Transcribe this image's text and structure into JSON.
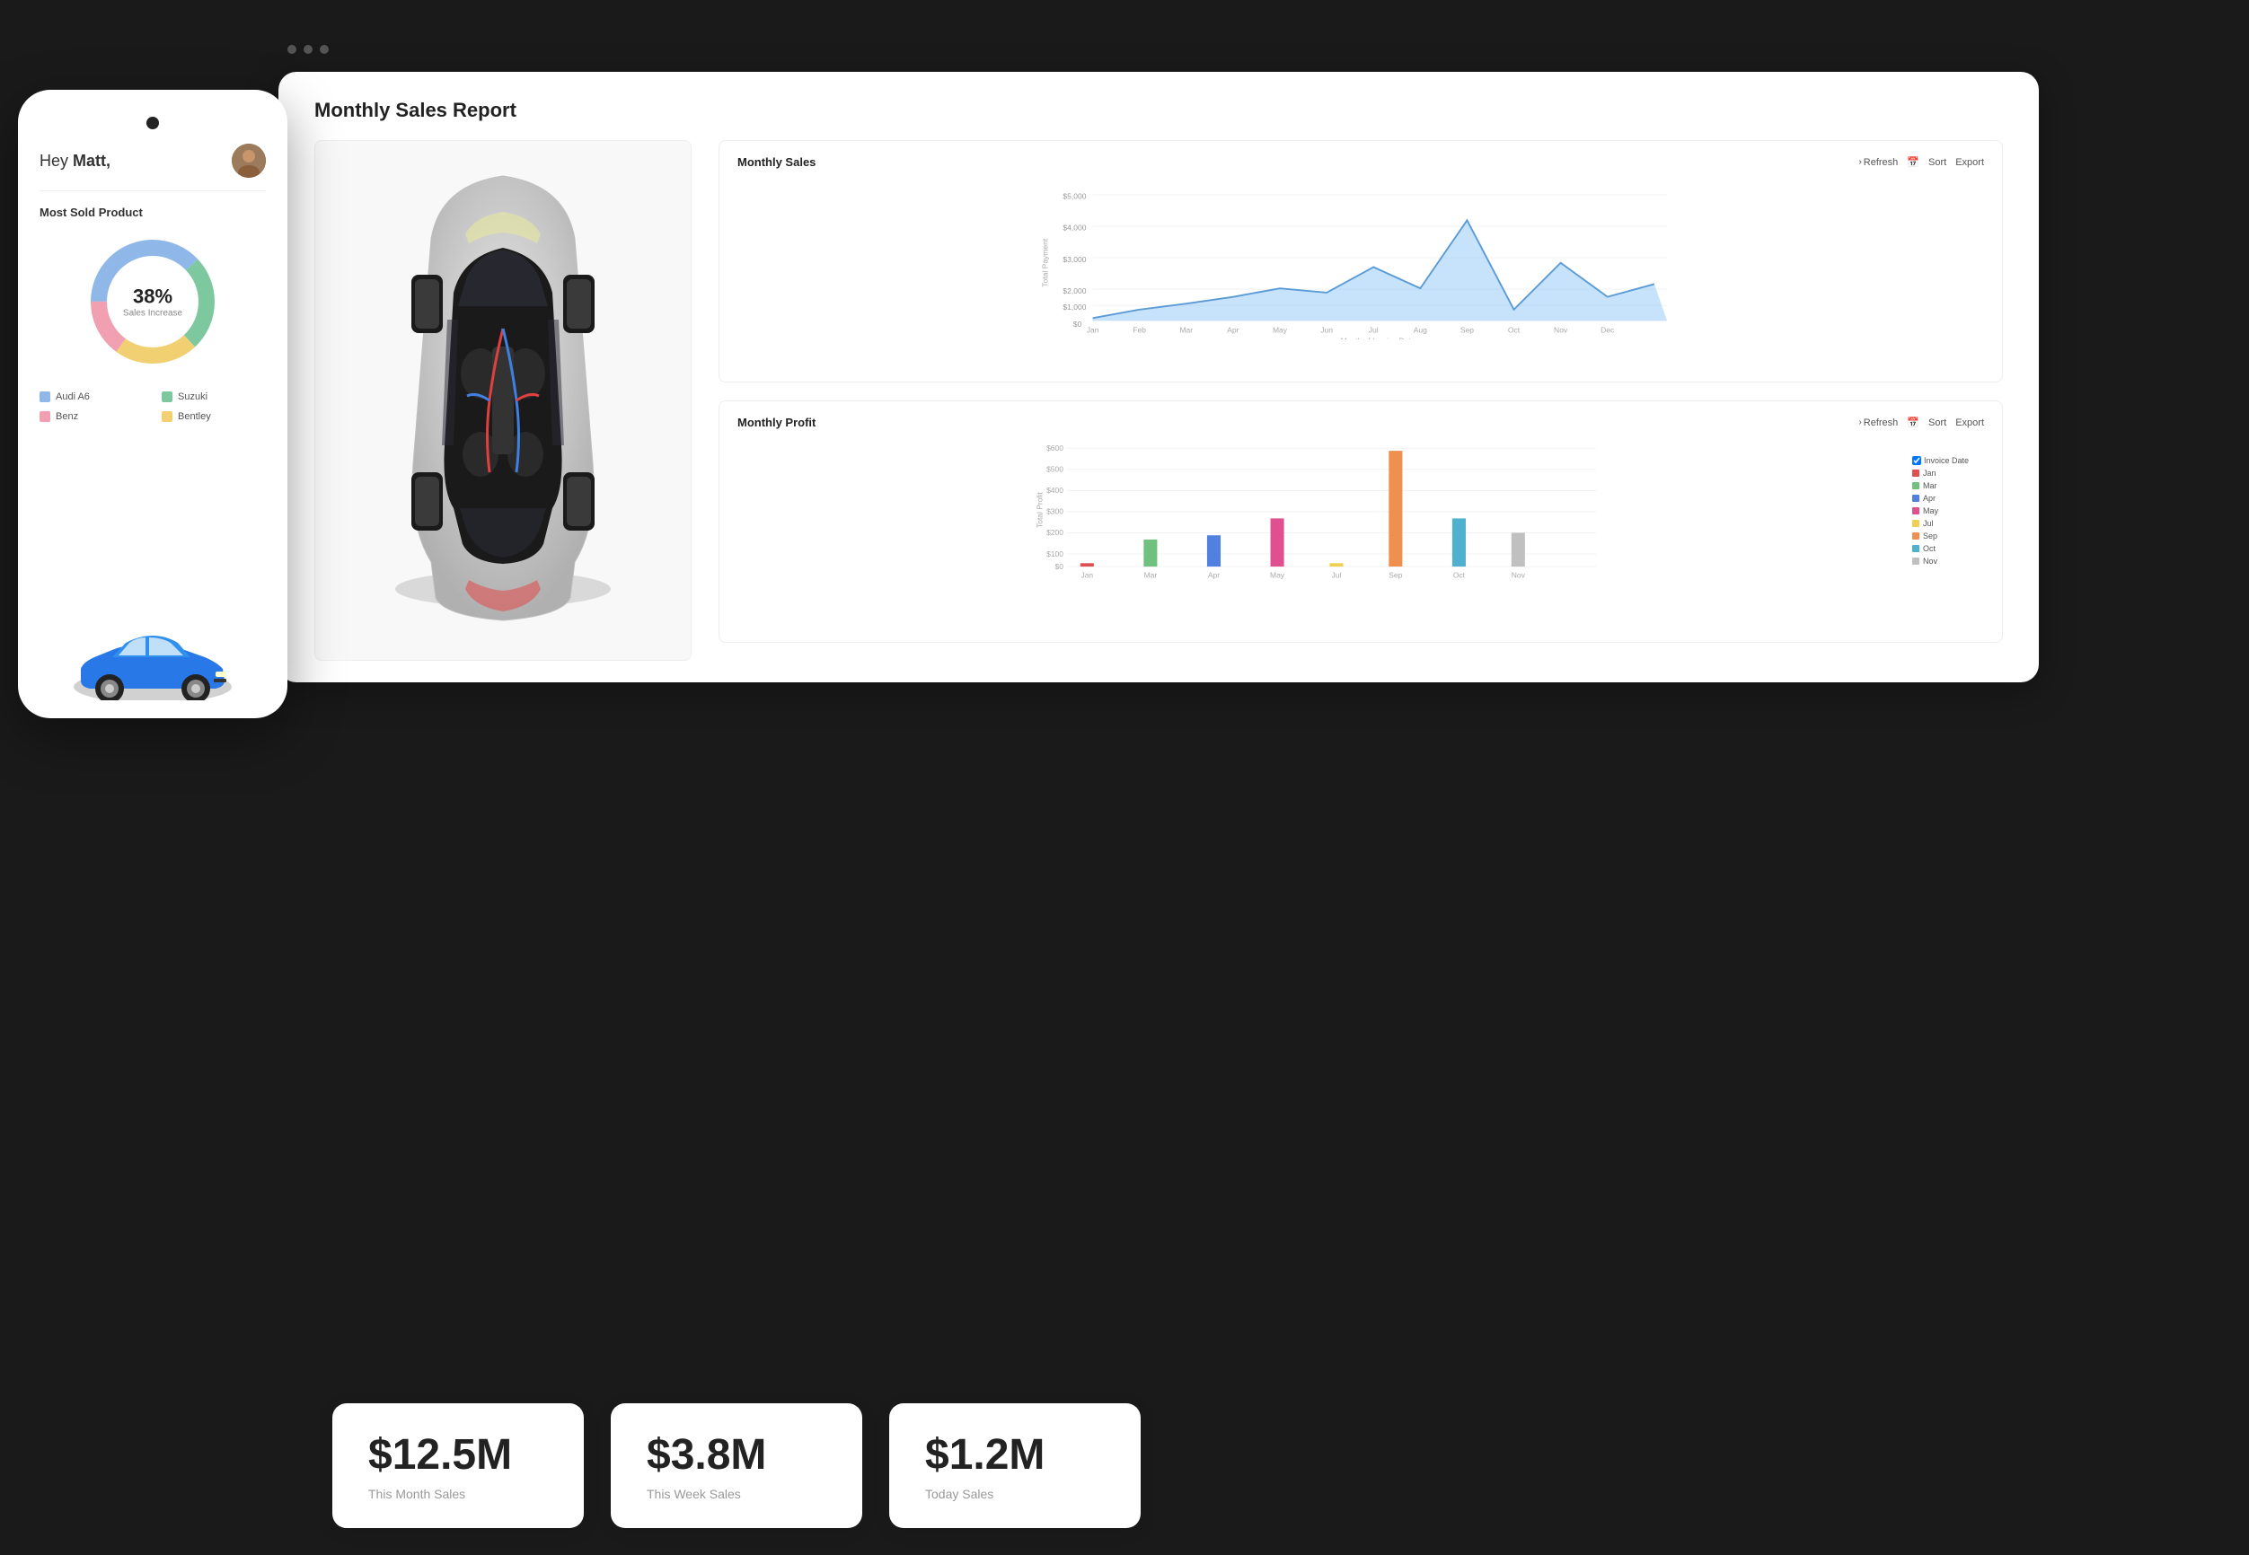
{
  "phone": {
    "greeting": "Hey ",
    "username": "Matt,",
    "most_sold_title": "Most Sold Product",
    "donut_percent": "38%",
    "donut_sub": "Sales Increase",
    "legend": [
      {
        "label": "Audi A6",
        "color": "#8FB8E8"
      },
      {
        "label": "Suzuki",
        "color": "#7EC8A0"
      },
      {
        "label": "Benz",
        "color": "#F0A0B0"
      },
      {
        "label": "Bentley",
        "color": "#F0D070"
      }
    ]
  },
  "dashboard": {
    "title": "Monthly Sales Report",
    "monthly_sales_chart": {
      "title": "Monthly Sales",
      "refresh_label": "Refresh",
      "sort_label": "Sort",
      "export_label": "Export",
      "y_axis_label": "Total Payment",
      "x_axis_label": "Month of Invoice Date",
      "y_ticks": [
        "$0",
        "$1,000",
        "$2,000",
        "$3,000",
        "$4,000",
        "$5,000"
      ],
      "x_ticks": [
        "Jan",
        "Feb",
        "Mar",
        "Apr",
        "May",
        "Jun",
        "Jul",
        "Aug",
        "Sep",
        "Oct",
        "Nov",
        "Dec"
      ]
    },
    "monthly_profit_chart": {
      "title": "Monthly Profit",
      "refresh_label": "Refresh",
      "sort_label": "Sort",
      "export_label": "Export",
      "y_axis_label": "Total Profit",
      "checkbox_label": "Invoice Date",
      "y_ticks": [
        "$0",
        "$100",
        "$200",
        "$300",
        "$400",
        "$500",
        "$600"
      ],
      "x_ticks": [
        "Jan",
        "Mar",
        "Apr",
        "May",
        "Jul",
        "Sep",
        "Oct",
        "Nov"
      ],
      "legend": [
        {
          "label": "Jan",
          "color": "#E05050"
        },
        {
          "label": "Mar",
          "color": "#70C080"
        },
        {
          "label": "Apr",
          "color": "#5080E0"
        },
        {
          "label": "May",
          "color": "#E05090"
        },
        {
          "label": "Jul",
          "color": "#F0D050"
        },
        {
          "label": "Sep",
          "color": "#F09050"
        },
        {
          "label": "Oct",
          "color": "#50B0D0"
        },
        {
          "label": "Nov",
          "color": "#C0C0C0"
        }
      ]
    }
  },
  "stats": [
    {
      "value": "$12.5M",
      "label": "This Month Sales"
    },
    {
      "value": "$3.8M",
      "label": "This Week Sales"
    },
    {
      "value": "$1.2M",
      "label": "Today Sales"
    }
  ],
  "dots": [
    "•",
    "•",
    "•"
  ]
}
